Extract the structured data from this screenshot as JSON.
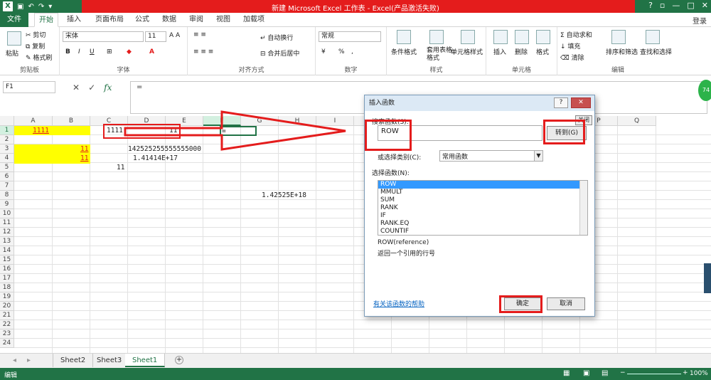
{
  "titlebar": {
    "title": "新建 Microsoft Excel 工作表 - Excel(产品激活失败)",
    "minimize": "?",
    "close": "✕",
    "restore": "□",
    "ribbon_opts": "▫",
    "min2": "—"
  },
  "tabs": {
    "file": "文件",
    "items": [
      "开始",
      "插入",
      "页面布局",
      "公式",
      "数据",
      "审阅",
      "视图",
      "加载项"
    ],
    "login": "登录"
  },
  "ribbon": {
    "clipboard": {
      "paste": "粘贴",
      "cut": "剪切",
      "copy": "复制",
      "format_painter": "格式刷",
      "label": "剪贴板"
    },
    "font": {
      "name": "宋体",
      "size": "11",
      "label": "字体",
      "bold": "B",
      "italic": "I",
      "underline": "U"
    },
    "alignment": {
      "wrap": "自动换行",
      "merge": "合并后居中",
      "label": "对齐方式"
    },
    "number": {
      "format": "常规",
      "percent": "%",
      "comma": ",",
      "label": "数字"
    },
    "styles": {
      "cond": "条件格式",
      "table": "套用表格格式",
      "cell": "单元格样式",
      "label": "样式"
    },
    "cells": {
      "insert": "插入",
      "delete": "删除",
      "format": "格式",
      "label": "单元格"
    },
    "editing": {
      "autosum": "自动求和",
      "fill": "填充",
      "clear": "清除",
      "sort": "排序和筛选",
      "find": "查找和选择",
      "label": "编辑"
    }
  },
  "formula_bar": {
    "name_box": "F1",
    "formula": "=",
    "fx": "fx",
    "cancel": "✕",
    "enter": "✓"
  },
  "columns": [
    "A",
    "B",
    "C",
    "D",
    "E",
    "F",
    "G",
    "H",
    "I",
    "J",
    "K",
    "L",
    "M",
    "N",
    "O",
    "P",
    "Q"
  ],
  "rows": [
    "1",
    "2",
    "3",
    "4",
    "5",
    "6",
    "7",
    "8",
    "9",
    "10",
    "11",
    "12",
    "13",
    "14",
    "15",
    "16",
    "17",
    "18",
    "19",
    "20",
    "21",
    "22",
    "23",
    "24"
  ],
  "cells": {
    "a1": "1111",
    "c1": "1111",
    "d1": "11",
    "f1": "=",
    "b3": "11",
    "b4": "11",
    "c3": "142525255555555000",
    "c4": "1.41414E+17",
    "c5": "11",
    "g8": "1.42525E+18"
  },
  "sheets": [
    "Sheet2",
    "Sheet3",
    "Sheet1"
  ],
  "add_sheet": "+",
  "status": {
    "mode": "编辑",
    "zoom": "100%"
  },
  "dialog": {
    "title": "插入函数",
    "search_label": "搜索函数(S):",
    "search_value": "ROW",
    "go_button": "转到(G)",
    "category_label": "或选择类别(C):",
    "category_value": "常用函数",
    "select_label": "选择函数(N):",
    "functions": [
      "ROW",
      "MMULT",
      "SUM",
      "RANK",
      "IF",
      "RANK.EQ",
      "COUNTIF"
    ],
    "signature": "ROW(reference)",
    "description": "返回一个引用的行号",
    "help_link": "有关该函数的帮助",
    "ok": "确定",
    "cancel": "取消",
    "help_q": "?",
    "close": "✕",
    "side_btn": "关闭"
  },
  "colors": {
    "excel_green": "#217346",
    "highlight_red": "#e41c1c",
    "cell_yellow": "#ffff00",
    "select_blue": "#3399ff"
  }
}
